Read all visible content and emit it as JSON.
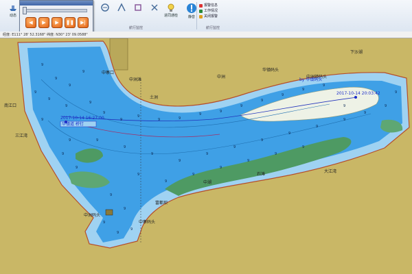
{
  "ribbon": {
    "buttons": [
      {
        "label": "动态",
        "icon": "ship-icon"
      },
      {
        "label": "",
        "icon": "chart-icon"
      },
      {
        "label": "",
        "icon": "chart-icon"
      },
      {
        "label": "",
        "icon": "chart-icon"
      },
      {
        "label": "",
        "icon": "chart-icon"
      },
      {
        "label": "进同通检",
        "icon": "bulb-icon"
      },
      {
        "label": "静音",
        "icon": "warning-icon"
      }
    ],
    "group_label": "航行监控",
    "group2_label": "航行监控",
    "side_menu": [
      {
        "label": "报警信息",
        "icon": "alarm-icon"
      },
      {
        "label": "工作情况",
        "icon": "work-icon"
      },
      {
        "label": "关闭报警",
        "icon": "close-alarm-icon"
      }
    ]
  },
  "status": {
    "text": "经度: E111° 28' 52.3168\"   纬度: N30° 23' 09.0588\""
  },
  "chart": {
    "place_labels": [
      "下沙湖",
      "中寨口",
      "中洲滩",
      "土洲",
      "中洲",
      "华镇码头",
      "中洲镇码头",
      "三江湾",
      "南江口",
      "大江湾",
      "中湖",
      "石滩",
      "中寨码头",
      "富都坝",
      "中洲码头"
    ],
    "track_labels": [
      "2017-10-14 20:03:42",
      "2017-10-14 16:27:00",
      "华镇道 桥钉",
      "by 华镇码头"
    ],
    "sounding": "9"
  },
  "colors": {
    "land": "#c9b766",
    "deep_water": "#3fa0e6",
    "shallow_water": "#9fd2f2",
    "sand": "#f0f0e8",
    "green_bar": "#4e9a63",
    "track": "#2233bb"
  }
}
